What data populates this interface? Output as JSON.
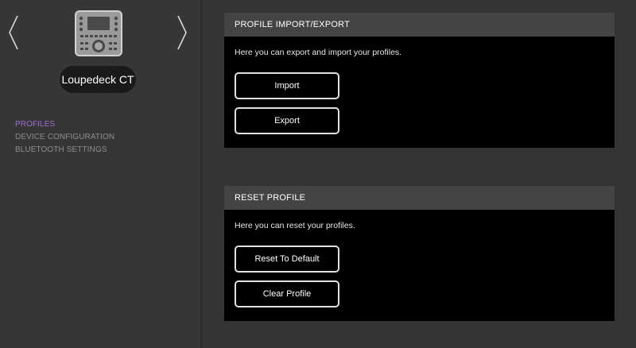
{
  "device": {
    "name": "Loupedeck CT",
    "icon": "loupedeck-device-icon"
  },
  "nav": {
    "prev_icon": "chevron-left-icon",
    "next_icon": "chevron-right-icon"
  },
  "sidebar": {
    "items": [
      {
        "label": "PROFILES",
        "active": true
      },
      {
        "label": "DEVICE CONFIGURATION",
        "active": false
      },
      {
        "label": "BLUETOOTH SETTINGS",
        "active": false
      }
    ]
  },
  "sections": {
    "import_export": {
      "title": "PROFILE IMPORT/EXPORT",
      "description": "Here you can export and import your profiles.",
      "import_label": "Import",
      "export_label": "Export"
    },
    "reset": {
      "title": "RESET PROFILE",
      "description": "Here you can reset your profiles.",
      "reset_label": "Reset To Default",
      "clear_label": "Clear Profile"
    }
  },
  "colors": {
    "accent": "#9b6fd0",
    "panel_bg": "#000000",
    "header_bg": "#444444",
    "sidebar_bg": "#363636"
  }
}
